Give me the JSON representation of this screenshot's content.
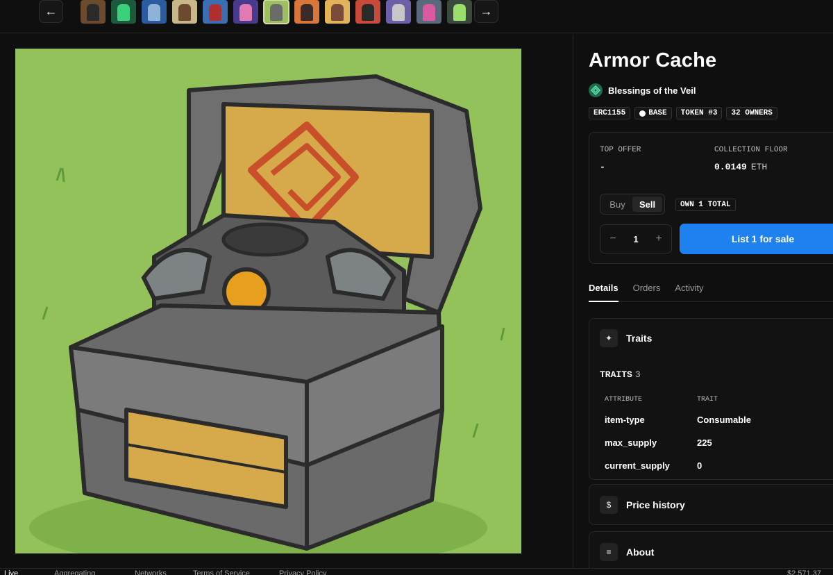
{
  "nav": {
    "prev_icon": "arrow-left-icon",
    "next_icon": "arrow-right-icon"
  },
  "thumbnails": [
    {
      "bg": "#6b4a2e",
      "fig": "#2a2a2a",
      "active": false
    },
    {
      "bg": "#1d5a3b",
      "fig": "#3bd07a",
      "active": false
    },
    {
      "bg": "#2b5d9e",
      "fig": "#8fb2d8",
      "active": false
    },
    {
      "bg": "#c9b78a",
      "fig": "#6b4a2e",
      "active": false
    },
    {
      "bg": "#3b6fb4",
      "fig": "#b03030",
      "active": false
    },
    {
      "bg": "#4a3a8e",
      "fig": "#e07ab0",
      "active": false
    },
    {
      "bg": "#9cc060",
      "fig": "#6b6b6b",
      "active": true
    },
    {
      "bg": "#d9773a",
      "fig": "#3a2a2a",
      "active": false
    },
    {
      "bg": "#e3b35a",
      "fig": "#7a4a3a",
      "active": false
    },
    {
      "bg": "#c74a3a",
      "fig": "#2a2a2a",
      "active": false
    },
    {
      "bg": "#6d5fa8",
      "fig": "#c7c7c7",
      "active": false
    },
    {
      "bg": "#5b6a7a",
      "fig": "#d95aa0",
      "active": false
    },
    {
      "bg": "#3a4a3a",
      "fig": "#9adf6a",
      "active": false
    }
  ],
  "item": {
    "title": "Armor Cache",
    "collection": "Blessings of the Veil",
    "badges": {
      "standard": "ERC1155",
      "chain": "BASE",
      "token": "TOKEN #3",
      "owners": "32 OWNERS"
    }
  },
  "trade": {
    "top_offer_label": "TOP OFFER",
    "top_offer_value": "-",
    "floor_label": "COLLECTION FLOOR",
    "floor_value": "0.0149",
    "floor_unit": "ETH",
    "buy_label": "Buy",
    "sell_label": "Sell",
    "own_label": "OWN 1 TOTAL",
    "quantity": "1",
    "minus": "−",
    "plus": "+",
    "list_button": "List 1 for sale"
  },
  "tabs": [
    "Details",
    "Orders",
    "Activity"
  ],
  "traits": {
    "heading": "Traits",
    "count_label": "TRAITS",
    "count": "3",
    "col_attribute": "ATTRIBUTE",
    "col_trait": "TRAIT",
    "rows": [
      {
        "attribute": "item-type",
        "trait": "Consumable"
      },
      {
        "attribute": "max_supply",
        "trait": "225"
      },
      {
        "attribute": "current_supply",
        "trait": "0"
      }
    ]
  },
  "price_history": {
    "heading": "Price history"
  },
  "about": {
    "heading": "About"
  },
  "footer": {
    "live": "Live",
    "aggregating": "Aggregating",
    "networks": "Networks",
    "terms": "Terms of Service",
    "privacy": "Privacy Policy",
    "eth_price": "$2,571.37"
  },
  "colors": {
    "accent": "#1e81f0",
    "artwork_bg": "#94c25a"
  }
}
